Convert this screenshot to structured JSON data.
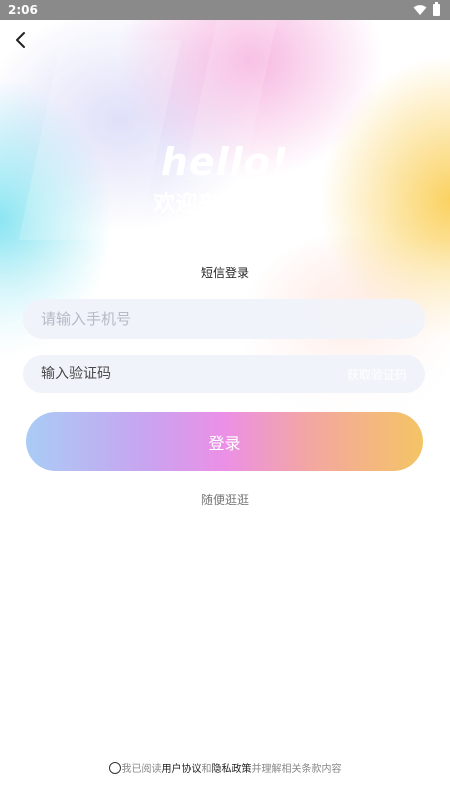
{
  "status_bar": {
    "time": "2:06",
    "icons": [
      "wifi-icon",
      "battery-icon"
    ]
  },
  "nav": {
    "back_icon": "chevron-left-icon"
  },
  "brand": {
    "hello": "hello!",
    "welcome": "欢迎来到VC社"
  },
  "login": {
    "mode_label": "短信登录",
    "phone_placeholder": "请输入手机号",
    "phone_value": "",
    "code_placeholder": "输入验证码",
    "code_value": "",
    "get_code_label": "获取验证码",
    "submit_label": "登录",
    "browse_label": "随便逛逛"
  },
  "agreement": {
    "prefix": "我已阅读",
    "user_agreement": "用户协议",
    "and": "和",
    "privacy_policy": "隐私政策",
    "suffix": "并理解相关条款内容"
  },
  "colors": {
    "button_gradient": [
      "#a9ccf5",
      "#c8a4f0",
      "#eb90e6",
      "#f3a7a0",
      "#f4c465"
    ],
    "input_bg": "#f0f2fa",
    "status_bar_bg": "#8a8a8a"
  }
}
